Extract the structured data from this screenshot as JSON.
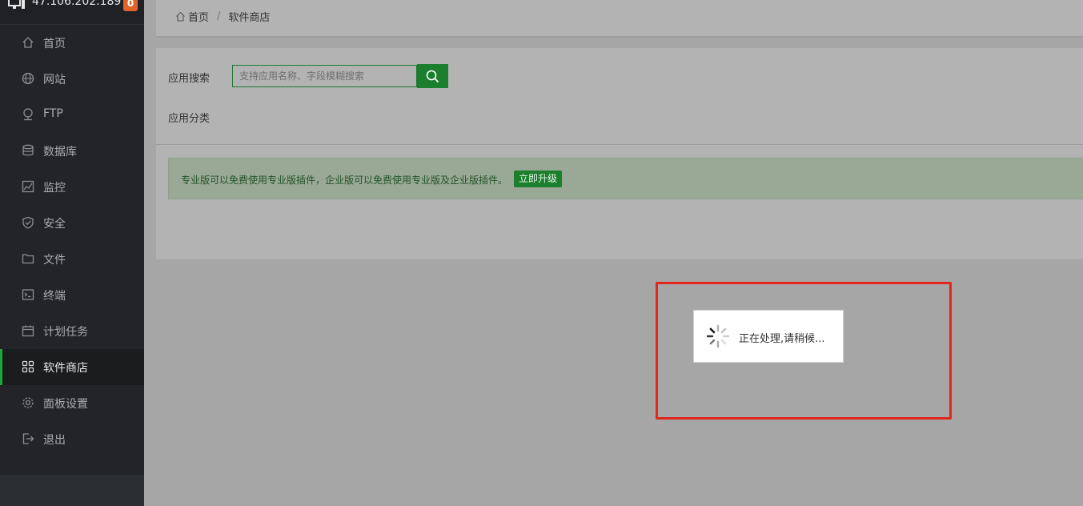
{
  "server": {
    "ip": "47.106.202.189",
    "alert_count": "0"
  },
  "sidebar": {
    "items": [
      {
        "label": "首页",
        "icon": "home-icon"
      },
      {
        "label": "网站",
        "icon": "globe-icon"
      },
      {
        "label": "FTP",
        "icon": "ftp-icon"
      },
      {
        "label": "数据库",
        "icon": "database-icon"
      },
      {
        "label": "监控",
        "icon": "monitor-icon"
      },
      {
        "label": "安全",
        "icon": "shield-icon"
      },
      {
        "label": "文件",
        "icon": "folder-icon"
      },
      {
        "label": "终端",
        "icon": "terminal-icon"
      },
      {
        "label": "计划任务",
        "icon": "calendar-icon"
      },
      {
        "label": "软件商店",
        "icon": "apps-grid-icon",
        "active": true
      },
      {
        "label": "面板设置",
        "icon": "gear-icon"
      },
      {
        "label": "退出",
        "icon": "logout-icon"
      }
    ]
  },
  "breadcrumb": {
    "home": "首页",
    "separator": "/",
    "current": "软件商店"
  },
  "search": {
    "label": "应用搜索",
    "placeholder": "支持应用名称、字段模糊搜索",
    "value": ""
  },
  "category": {
    "label": "应用分类"
  },
  "notice": {
    "text": "专业版可以免费使用专业版插件，企业版可以免费使用专业版及企业版插件。",
    "button": "立即升级"
  },
  "loading": {
    "text": "正在处理,请稍候..."
  },
  "colors": {
    "accent": "#20a53a",
    "highlight_frame": "#e0261d",
    "badge": "#e2632a"
  }
}
